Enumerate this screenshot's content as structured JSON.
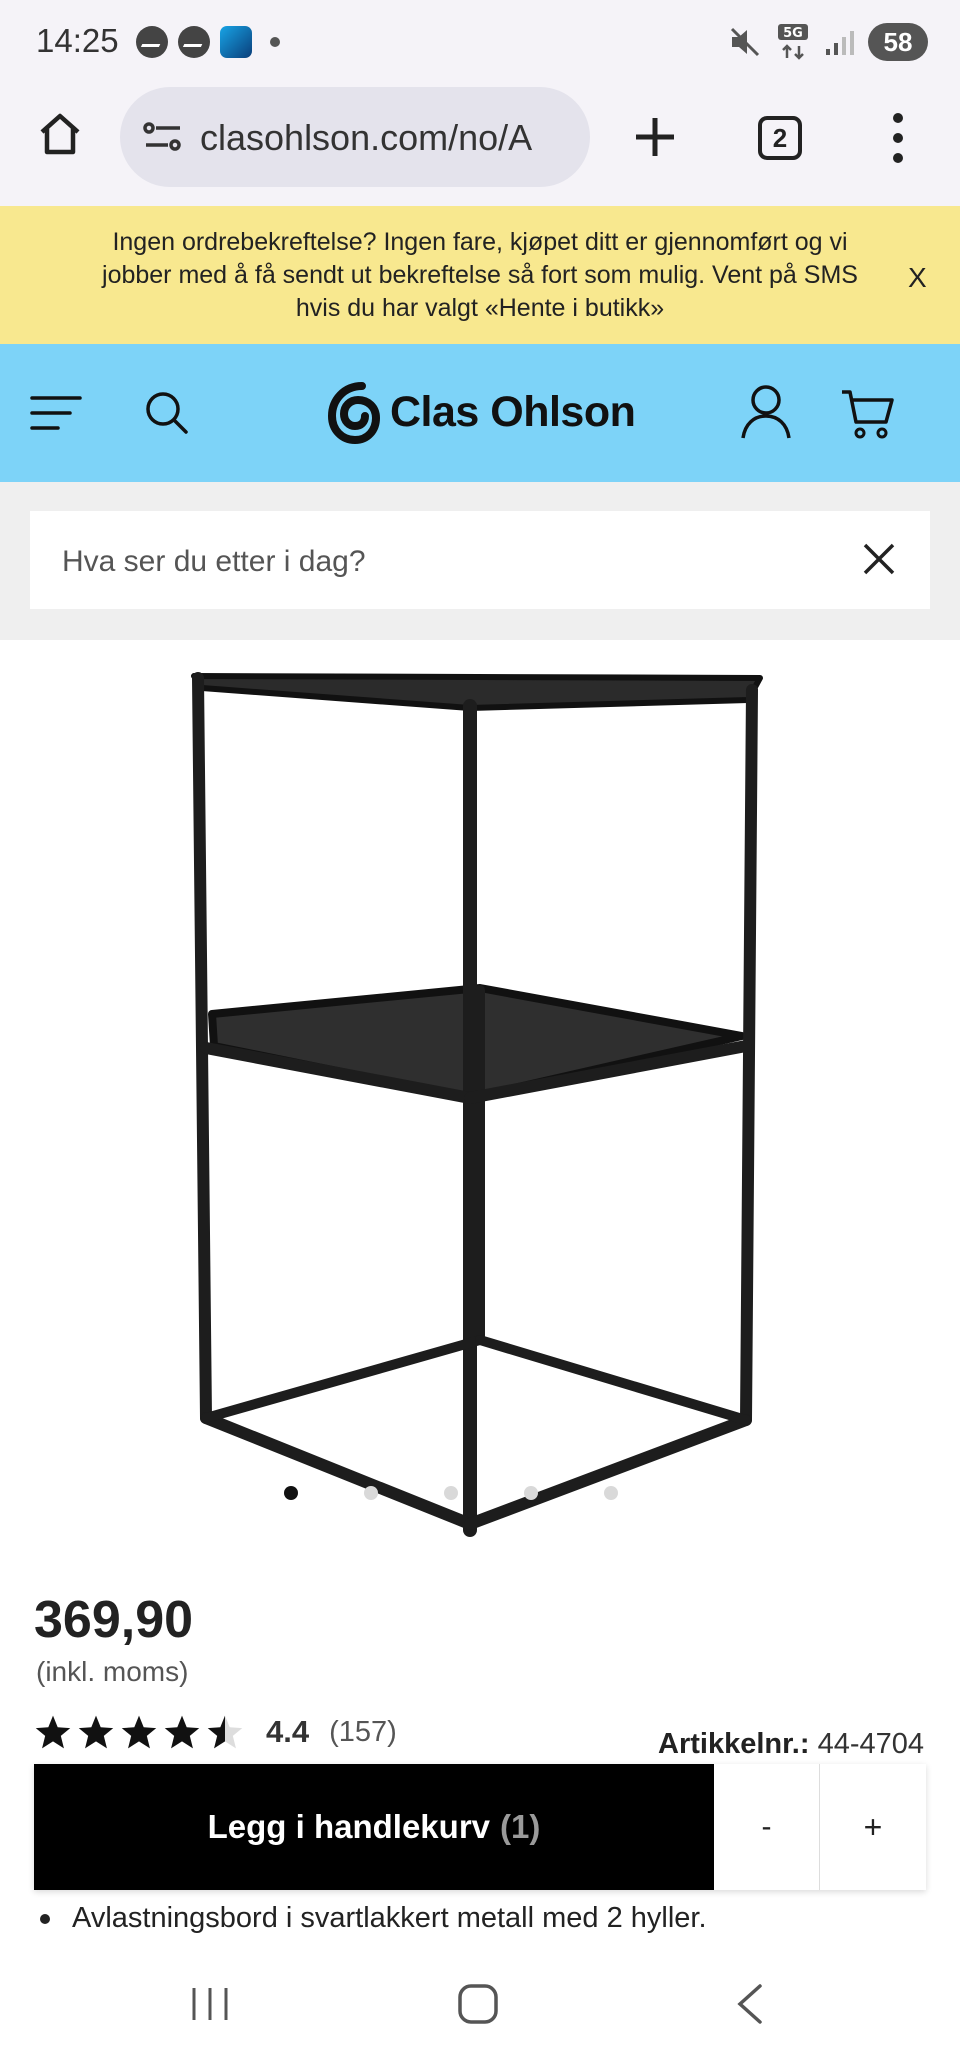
{
  "status_bar": {
    "time": "14:25",
    "battery": "58",
    "network": "5G"
  },
  "browser": {
    "url": "clasohlson.com/no/A",
    "tab_count": "2"
  },
  "banner": {
    "text": "Ingen ordrebekreftelse? Ingen fare, kjøpet ditt er gjennomført og vi jobber med å få sendt ut bekreftelse så fort som mulig. Vent på SMS hvis du har valgt «Hente i butikk»",
    "close_label": "X"
  },
  "header": {
    "logo_text": "Clas Ohlson",
    "brand_color": "#7dd3f8"
  },
  "search": {
    "placeholder": "Hva ser du etter i dag?"
  },
  "product": {
    "carousel_dots": 5,
    "active_slide": 1,
    "price": "369,90",
    "vat_note": "(inkl. moms)",
    "rating": "4.4",
    "rating_count": "(157)",
    "stars_filled": 4.4,
    "article_label": "Artikkelnr.:",
    "article_number": "44-4704",
    "description": "Avlastningsbord i svartlakkert metall med 2 hyller."
  },
  "cart": {
    "button_label": "Legg i handlekurv",
    "quantity": "(1)",
    "minus": "-",
    "plus": "+"
  }
}
